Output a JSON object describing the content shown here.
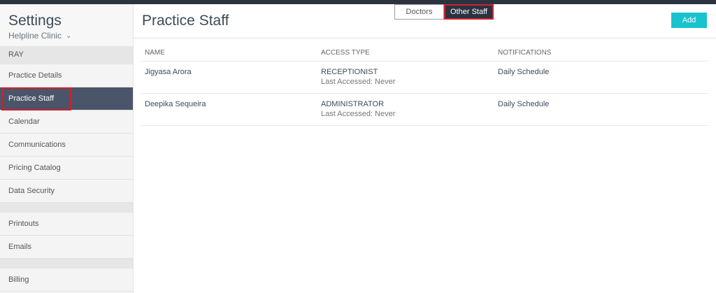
{
  "sidebar": {
    "title": "Settings",
    "clinic": "Helpline Clinic",
    "section_label": "RAY",
    "items": [
      {
        "label": "Practice Details"
      },
      {
        "label": "Practice Staff"
      },
      {
        "label": "Calendar"
      },
      {
        "label": "Communications"
      },
      {
        "label": "Pricing Catalog"
      },
      {
        "label": "Data Security"
      }
    ],
    "items2": [
      {
        "label": "Printouts"
      },
      {
        "label": "Emails"
      }
    ],
    "items3": [
      {
        "label": "Billing"
      }
    ]
  },
  "main": {
    "title": "Practice Staff",
    "tabs": [
      {
        "label": "Doctors"
      },
      {
        "label": "Other Staff"
      }
    ],
    "add_label": "Add",
    "table": {
      "headers": [
        "NAME",
        "ACCESS TYPE",
        "NOTIFICATIONS"
      ],
      "rows": [
        {
          "name": "Jigyasa Arora",
          "access": "RECEPTIONIST",
          "last": "Last Accessed: Never",
          "notif": "Daily Schedule"
        },
        {
          "name": "Deepika Sequeira",
          "access": "ADMINISTRATOR",
          "last": "Last Accessed: Never",
          "notif": "Daily Schedule"
        }
      ]
    }
  },
  "colors": {
    "accent": "#18c3cf",
    "active_nav": "#4b5569",
    "highlight": "#d0202e"
  }
}
